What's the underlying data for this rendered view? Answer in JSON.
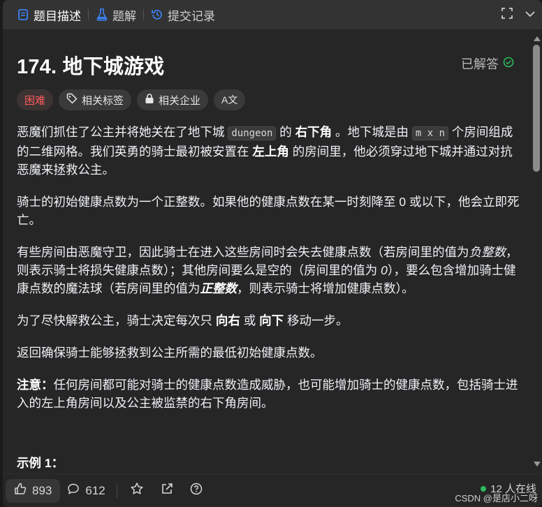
{
  "tabs": [
    {
      "label": "题目描述",
      "icon": "document-icon"
    },
    {
      "label": "题解",
      "icon": "flask-icon"
    },
    {
      "label": "提交记录",
      "icon": "history-icon"
    }
  ],
  "problem": {
    "title": "174. 地下城游戏",
    "status": "已解答",
    "tags": {
      "difficulty": "困难",
      "related_tags": "相关标签",
      "related_companies": "相关企业",
      "translate": "A文"
    }
  },
  "description": {
    "p1": {
      "a": "恶魔们抓住了公主并将她关在了地下城 ",
      "code1": "dungeon",
      "b": " 的 ",
      "bold1": "右下角",
      "c": " 。地下城是由 ",
      "code2": "m x n",
      "d": " 个房间组成的二维网格。我们英勇的骑士最初被安置在 ",
      "bold2": "左上角",
      "e": " 的房间里，他必须穿过地下城并通过对抗恶魔来拯救公主。"
    },
    "p2": "骑士的初始健康点数为一个正整数。如果他的健康点数在某一时刻降至 0 或以下，他会立即死亡。",
    "p3": {
      "a": "有些房间由恶魔守卫，因此骑士在进入这些房间时会失去健康点数（若房间里的值为",
      "i1": "负整数",
      "b": "，则表示骑士将损失健康点数）；其他房间要么是空的（房间里的值为 ",
      "i2": "0",
      "c": "），要么包含增加骑士健康点数的魔法球（若房间里的值为",
      "i3": "正整数",
      "d": "，则表示骑士将增加健康点数）。"
    },
    "p4": {
      "a": "为了尽快解救公主，骑士决定每次只 ",
      "bold1": "向右",
      "b": " 或 ",
      "bold2": "向下",
      "c": " 移动一步。"
    },
    "p5": "返回确保骑士能够拯救到公主所需的最低初始健康点数。",
    "p6": {
      "bold": "注意：",
      "text": "任何房间都可能对骑士的健康点数造成威胁，也可能增加骑士的健康点数，包括骑士进入的左上角房间以及公主被监禁的右下角房间。"
    },
    "example_heading": "示例 1："
  },
  "bottom": {
    "likes": "893",
    "comments": "612",
    "online": "12 人在线",
    "watermark": "CSDN @是店小二呀"
  },
  "colors": {
    "accent_hard": "#ff5c5c",
    "solved_green": "#2cbb5d",
    "panel_bg": "#262626"
  }
}
